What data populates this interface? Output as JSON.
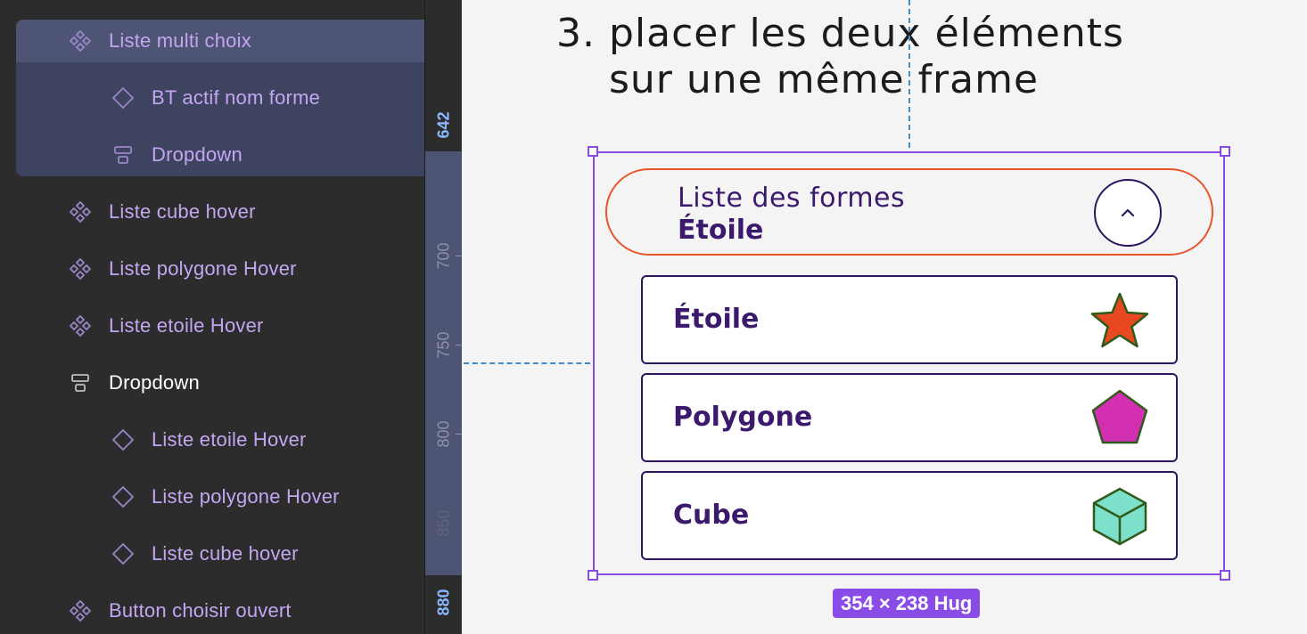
{
  "layers": {
    "items": [
      {
        "label": "Liste multi choix",
        "icon": "component-icon"
      },
      {
        "label": "BT actif nom forme",
        "icon": "instance-icon"
      },
      {
        "label": "Dropdown",
        "icon": "auto-layout-vertical-icon"
      },
      {
        "label": "Liste cube hover",
        "icon": "component-icon"
      },
      {
        "label": "Liste polygone Hover",
        "icon": "component-icon"
      },
      {
        "label": "Liste etoile Hover",
        "icon": "component-icon"
      },
      {
        "label": "Dropdown",
        "icon": "auto-layout-vertical-icon"
      },
      {
        "label": "Liste etoile Hover",
        "icon": "instance-icon"
      },
      {
        "label": "Liste polygone Hover",
        "icon": "instance-icon"
      },
      {
        "label": "Liste cube hover",
        "icon": "instance-icon"
      },
      {
        "label": "Button choisir ouvert",
        "icon": "component-icon"
      }
    ]
  },
  "ruler": {
    "labels": [
      "642",
      "700",
      "750",
      "800",
      "850",
      "880"
    ]
  },
  "canvas": {
    "step_number": "3.",
    "title_line1": "placer les deux éléments",
    "title_line2": "sur une même frame",
    "dropdown": {
      "label": "Liste des formes",
      "value": "Étoile",
      "toggle_icon": "chevron-up-icon"
    },
    "options": [
      {
        "label": "Étoile",
        "shape": "star-shape",
        "color": "#e8481f"
      },
      {
        "label": "Polygone",
        "shape": "pentagon-shape",
        "color": "#d22fb3"
      },
      {
        "label": "Cube",
        "shape": "cube-shape",
        "color": "#7de0cb"
      }
    ],
    "size_badge": "354 × 238 Hug"
  },
  "colors": {
    "selection": "#8a4ce6",
    "guide": "#3d8bd4",
    "dropdown_border": "#e8552a",
    "text_purple": "#3b1a6e",
    "layer_text": "#c3a6f2"
  }
}
